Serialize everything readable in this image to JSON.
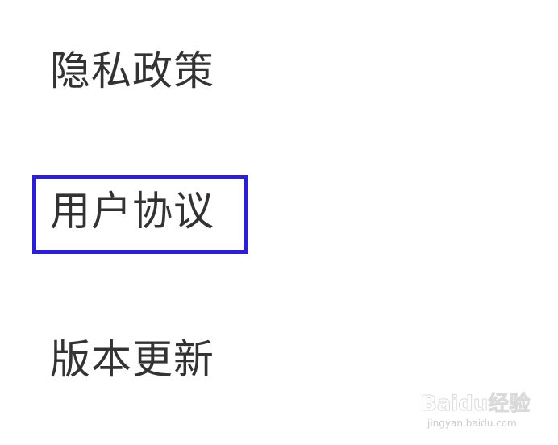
{
  "menu": {
    "items": [
      {
        "label": "隐私政策"
      },
      {
        "label": "用户协议"
      },
      {
        "label": "版本更新"
      }
    ],
    "highlighted_index": 1,
    "highlight_color": "#2b1fd0",
    "text_color": "#333333"
  },
  "watermark": {
    "brand_text": "Baidu经验",
    "sub_text": "jingyan.baidu.com"
  }
}
